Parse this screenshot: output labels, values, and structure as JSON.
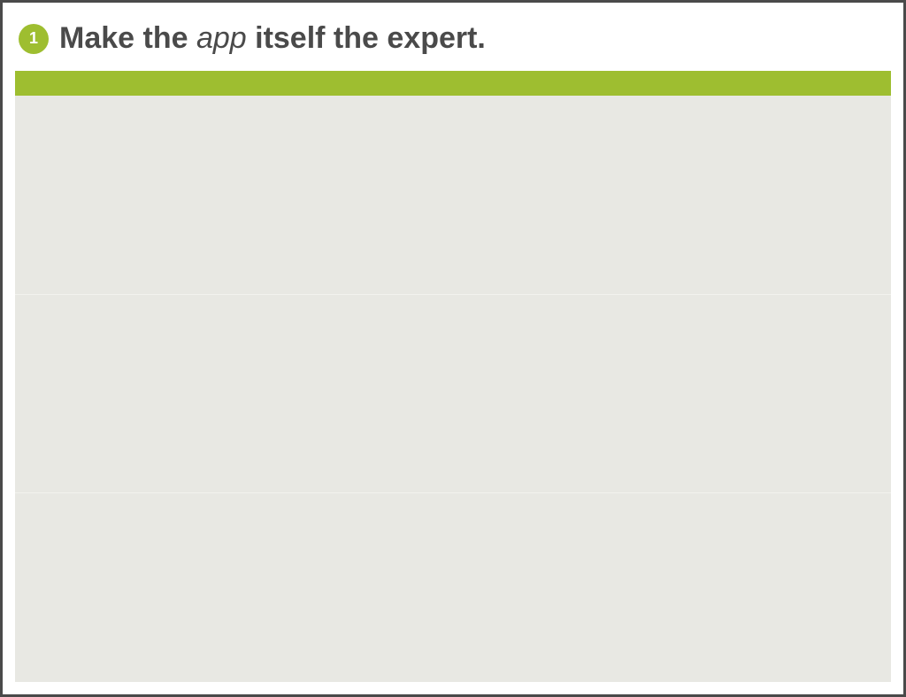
{
  "header": {
    "badge_number": "1",
    "title_parts": {
      "before": "Make the ",
      "italic": "app",
      "after": " itself the expert."
    }
  },
  "colors": {
    "accent_green": "#9ebe30",
    "panel_gray": "#e8e8e3",
    "border_dark": "#4a4a4a",
    "text_dark": "#4a4a4a"
  }
}
